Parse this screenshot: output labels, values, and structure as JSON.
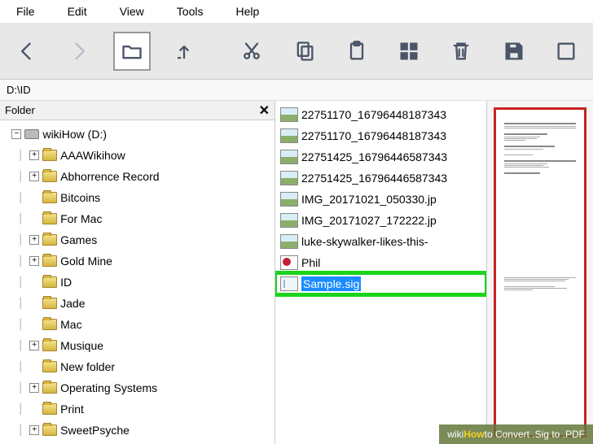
{
  "menu": {
    "file": "File",
    "edit": "Edit",
    "view": "View",
    "tools": "Tools",
    "help": "Help"
  },
  "path": "D:\\ID",
  "folderPanel": {
    "title": "Folder"
  },
  "tree": {
    "root": "wikiHow (D:)",
    "items": [
      {
        "label": "AAAWikihow",
        "exp": "+"
      },
      {
        "label": "Abhorrence Record",
        "exp": "+"
      },
      {
        "label": "Bitcoins",
        "exp": ""
      },
      {
        "label": "For Mac",
        "exp": ""
      },
      {
        "label": "Games",
        "exp": "+"
      },
      {
        "label": "Gold Mine",
        "exp": "+"
      },
      {
        "label": "ID",
        "exp": ""
      },
      {
        "label": "Jade",
        "exp": ""
      },
      {
        "label": "Mac",
        "exp": ""
      },
      {
        "label": "Musique",
        "exp": "+"
      },
      {
        "label": "New folder",
        "exp": ""
      },
      {
        "label": "Operating Systems",
        "exp": "+"
      },
      {
        "label": "Print",
        "exp": ""
      },
      {
        "label": "SweetPsyche",
        "exp": "+"
      }
    ]
  },
  "files": [
    {
      "name": "22751170_16796448187343",
      "type": "img"
    },
    {
      "name": "22751170_16796448187343",
      "type": "img"
    },
    {
      "name": "22751425_16796446587343",
      "type": "img"
    },
    {
      "name": "22751425_16796446587343",
      "type": "img"
    },
    {
      "name": "IMG_20171021_050330.jp",
      "type": "img"
    },
    {
      "name": "IMG_20171027_172222.jp",
      "type": "img"
    },
    {
      "name": "luke-skywalker-likes-this-",
      "type": "img"
    },
    {
      "name": "Phil",
      "type": "pdf"
    },
    {
      "name": "Sample.sig",
      "type": "doc",
      "selected": true
    }
  ],
  "watermark": {
    "prefix": "wiki",
    "brand": "How",
    "text": " to Convert .Sig to .PDF"
  }
}
